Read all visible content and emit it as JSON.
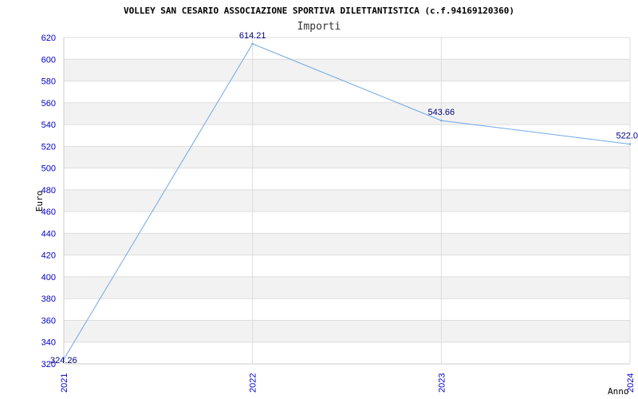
{
  "chart_data": {
    "type": "line",
    "title": "VOLLEY SAN CESARIO ASSOCIAZIONE SPORTIVA DILETTANTISTICA (c.f.94169120360)",
    "subtitle": "Importi",
    "xlabel": "Anno",
    "ylabel": "Euro",
    "categories": [
      "2021",
      "2022",
      "2023",
      "2024"
    ],
    "series": [
      {
        "values": [
          324.26,
          614.21,
          543.66,
          522.0
        ],
        "labels": [
          "324.26",
          "614.21",
          "543.66",
          "522.0"
        ]
      }
    ],
    "ylim": [
      320,
      620
    ],
    "yticks": [
      320,
      340,
      360,
      380,
      400,
      420,
      440,
      460,
      480,
      500,
      520,
      540,
      560,
      580,
      600,
      620
    ],
    "grid": true,
    "colors": {
      "line": "#6fa8e6",
      "band": "#f2f2f2",
      "tick": "#0000cc",
      "dlabel": "#000080"
    }
  }
}
